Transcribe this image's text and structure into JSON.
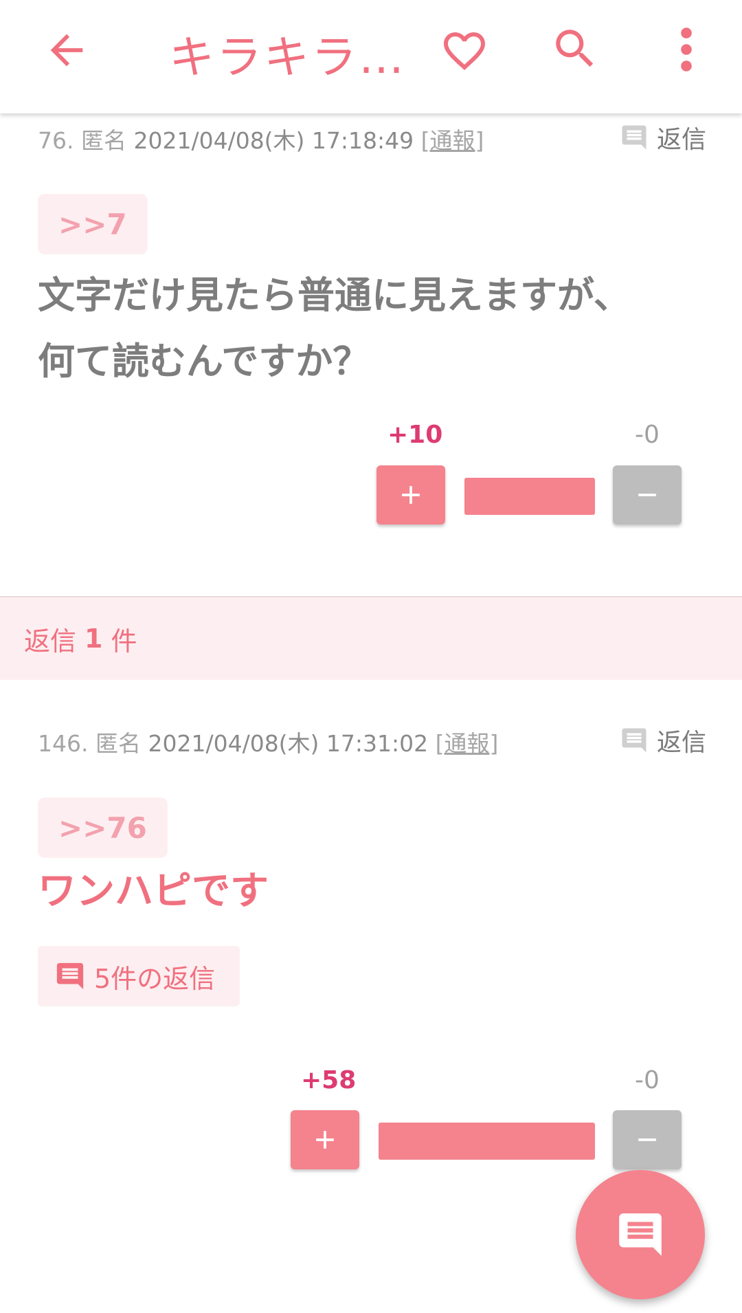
{
  "colors": {
    "accent": "#f0707f",
    "plus_count": "#dd3b71",
    "button": "#f4838d",
    "minus_button": "#bdbdbd",
    "tint": "#fdeff1"
  },
  "appbar": {
    "title": "キラキラ…",
    "icons": [
      "arrow-back-icon",
      "heart-outline-icon",
      "search-icon",
      "more-vert-icon"
    ]
  },
  "posts": [
    {
      "number": "76.",
      "author": "匿名",
      "datetime": "2021/04/08(木) 17:18:49",
      "report": "通報",
      "reply_label": "返信",
      "anchor": ">>7",
      "body_lines": [
        "文字だけ見たら普通に見えますが、",
        "何て読むんですか？"
      ],
      "plus": "+10",
      "minus": "-0",
      "plus_share": 1.0
    },
    {
      "number": "146.",
      "author": "匿名",
      "datetime": "2021/04/08(木) 17:31:02",
      "report": "通報",
      "reply_label": "返信",
      "anchor": ">>76",
      "body_lines": [
        "ワンハピです"
      ],
      "replies_button": "5件の返信",
      "plus": "+58",
      "minus": "-0",
      "plus_share": 1.0
    }
  ],
  "reply_band": {
    "prefix": "返信",
    "count": "1",
    "suffix": "件"
  },
  "fab": {
    "icon": "comment-icon"
  }
}
